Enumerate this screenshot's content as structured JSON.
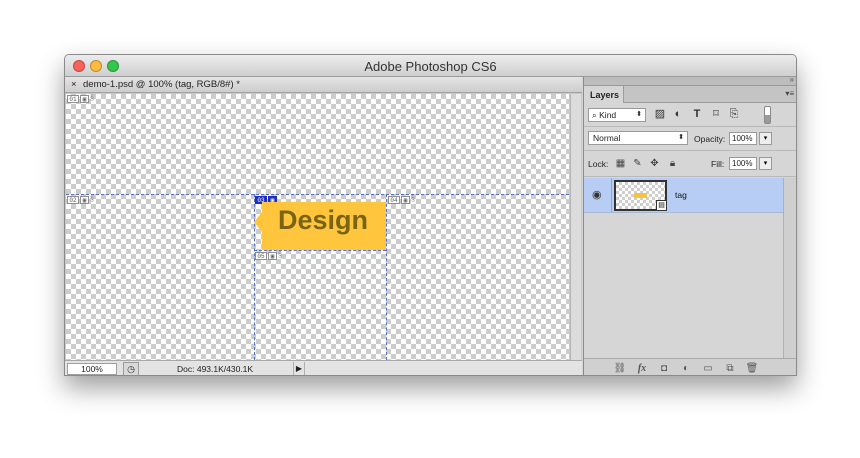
{
  "window": {
    "title": "Adobe Photoshop CS6",
    "controls": [
      "close",
      "minimize",
      "zoom"
    ]
  },
  "document": {
    "tab_close": "×",
    "tab_name": "demo-1.psd @ 100% (tag, RGB/8#) *",
    "slices": [
      {
        "num": "01",
        "selected": false
      },
      {
        "num": "02",
        "selected": false
      },
      {
        "num": "03",
        "selected": true
      },
      {
        "num": "04",
        "selected": false
      },
      {
        "num": "05",
        "selected": false
      }
    ],
    "tag_text": "Design",
    "tag_color": "#ffc53d",
    "statusbar": {
      "zoom": "100%",
      "doc_info": "Doc: 493.1K/430.1K"
    }
  },
  "layers_panel": {
    "tab": "Layers",
    "filter": {
      "kind_label": "Kind",
      "icons": [
        "image-icon",
        "adjustment-icon",
        "type-icon",
        "shape-icon",
        "smart-object-icon"
      ]
    },
    "blend_mode": "Normal",
    "opacity_label": "Opacity:",
    "opacity_value": "100%",
    "lock_label": "Lock:",
    "fill_label": "Fill:",
    "fill_value": "100%",
    "layers": [
      {
        "name": "tag",
        "visible": true,
        "selected": true
      }
    ],
    "footer_icons": [
      "link-icon",
      "fx-icon",
      "mask-icon",
      "adjustment-icon",
      "group-folder-icon",
      "new-layer-icon",
      "trash-icon"
    ]
  },
  "colors": {
    "selection_blue": "#1f2fbf",
    "layer_selected": "#b7cdf3",
    "slice_guides": "#5670c9"
  }
}
